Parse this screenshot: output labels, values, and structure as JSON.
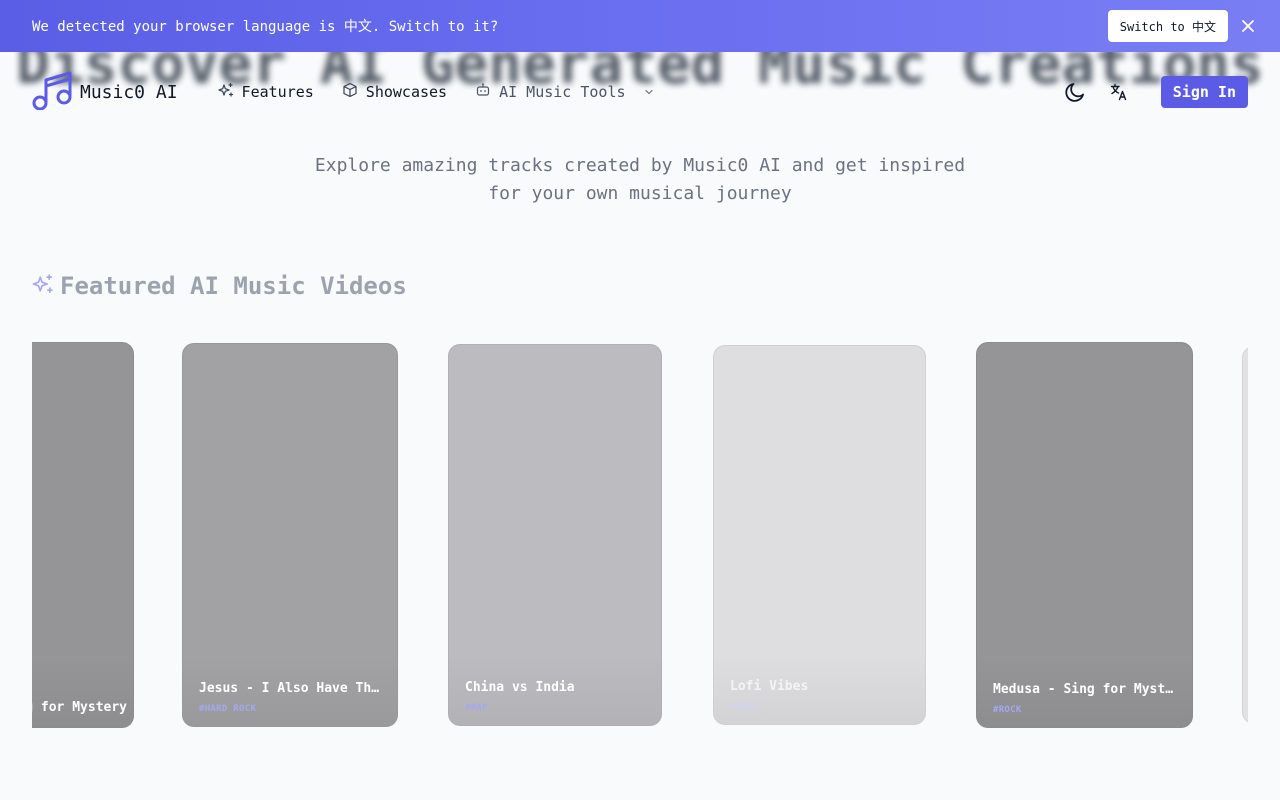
{
  "banner": {
    "message": "We detected your browser language is 中文. Switch to it?",
    "switch_label": "Switch to 中文"
  },
  "brand": {
    "name": "Music0 AI"
  },
  "nav": {
    "features": "Features",
    "showcases": "Showcases",
    "tools": "AI Music Tools",
    "signin": "Sign In"
  },
  "hero": {
    "title": "Discover AI Generated Music Creations",
    "subtitle_line1": "Explore amazing tracks created by Music0 AI and get inspired",
    "subtitle_line2": "for your own musical journey"
  },
  "section": {
    "title": "Featured AI Music Videos"
  },
  "cards": [
    {
      "title": "Medusa - Sing for Mystery",
      "tag": ""
    },
    {
      "title": "Jesus - I Also Have Thorns",
      "tag": "#HARD ROCK"
    },
    {
      "title": "China vs India",
      "tag": "#RAP"
    },
    {
      "title": "Lofi Vibes",
      "tag": "#LOFI"
    },
    {
      "title": "Medusa - Sing for Mystery",
      "tag": "#ROCK"
    }
  ],
  "colors": {
    "accent": "#5b5be6",
    "banner": "#6366f1",
    "tag": "#a5a8f0"
  }
}
